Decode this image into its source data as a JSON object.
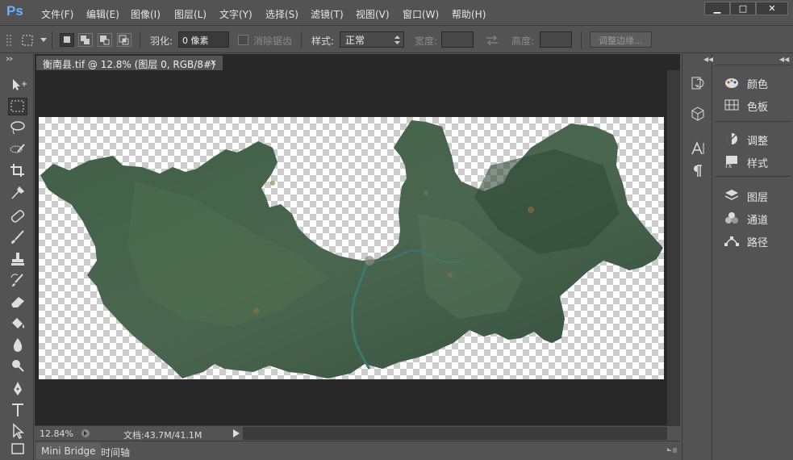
{
  "app": {
    "logo": "Ps"
  },
  "menu": [
    "文件(F)",
    "编辑(E)",
    "图像(I)",
    "图层(L)",
    "文字(Y)",
    "选择(S)",
    "滤镜(T)",
    "视图(V)",
    "窗口(W)",
    "帮助(H)"
  ],
  "window_controls": {
    "minimize": "▁",
    "maximize": "□",
    "close": "✕"
  },
  "options": {
    "feather_label": "羽化:",
    "feather_value": "0 像素",
    "antialias_label": "消除锯齿",
    "style_label": "样式:",
    "style_value": "正常",
    "width_label": "宽度:",
    "height_label": "高度:",
    "refine_edge_label": "调整边缘..."
  },
  "document": {
    "tab_title": "衡南县.tif @ 12.8% (图层 0, RGB/8#)",
    "tab_close": "×",
    "zoom": "12.84%",
    "doc_info": "文档:43.7M/41.1M"
  },
  "bottom_tabs": [
    "Mini Bridge",
    "时间轴"
  ],
  "panels": {
    "group1": [
      {
        "label": "颜色",
        "icon": "color-palette-icon"
      },
      {
        "label": "色板",
        "icon": "swatches-icon"
      }
    ],
    "group2": [
      {
        "label": "调整",
        "icon": "adjustments-icon"
      },
      {
        "label": "样式",
        "icon": "styles-fx-icon"
      }
    ],
    "group3": [
      {
        "label": "图层",
        "icon": "layers-icon"
      },
      {
        "label": "通道",
        "icon": "channels-icon"
      },
      {
        "label": "路径",
        "icon": "paths-icon"
      }
    ]
  },
  "dock_icons": [
    "history-icon",
    "3d-cube-icon",
    "character-icon",
    "paragraph-icon"
  ],
  "map_colors": {
    "dark_forest": "#2f4a36",
    "mid_green": "#4a6a4c",
    "river": "#3c7a6e",
    "soil": "#8a6a4a"
  }
}
